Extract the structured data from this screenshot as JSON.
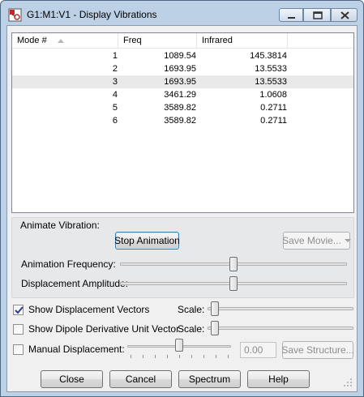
{
  "window": {
    "title": "G1:M1:V1 - Display Vibrations"
  },
  "list": {
    "columns": {
      "mode": "Mode #",
      "freq": "Freq",
      "infrared": "Infrared"
    },
    "rows": [
      {
        "mode": "1",
        "freq": "1089.54",
        "infrared": "145.3814"
      },
      {
        "mode": "2",
        "freq": "1693.95",
        "infrared": "13.5533"
      },
      {
        "mode": "3",
        "freq": "1693.95",
        "infrared": "13.5533"
      },
      {
        "mode": "4",
        "freq": "3461.29",
        "infrared": "1.0608"
      },
      {
        "mode": "5",
        "freq": "3589.82",
        "infrared": "0.2711"
      },
      {
        "mode": "6",
        "freq": "3589.82",
        "infrared": "0.2711"
      }
    ],
    "selected_mode": "3"
  },
  "animation": {
    "section_label": "Animate Vibration:",
    "stop_button": "Stop Animation",
    "save_movie_button": "Save Movie...",
    "frequency_label": "Animation Frequency:",
    "frequency_level": 0.5,
    "amplitude_label": "Displacement Amplitude:",
    "amplitude_level": 0.5
  },
  "options": {
    "show_vectors": {
      "label": "Show Displacement Vectors",
      "checked": true,
      "scale_label": "Scale:",
      "scale_level": 0.05
    },
    "show_dipole": {
      "label": "Show Dipole Derivative Unit Vector",
      "checked": false,
      "scale_label": "Scale:",
      "scale_level": 0.05
    },
    "manual": {
      "label": "Manual Displacement:",
      "checked": false,
      "value": "0.00",
      "level": 0.5,
      "save_structure_button": "Save Structure..."
    }
  },
  "buttons": {
    "close": "Close",
    "cancel": "Cancel",
    "spectrum": "Spectrum",
    "help": "Help"
  },
  "icons": {
    "app": "gaussview-icon",
    "minimize": "minimize-icon",
    "maximize": "maximize-icon",
    "close": "close-icon",
    "sort": "sort-ascending-icon",
    "check": "checkmark-icon",
    "grip": "resize-grip-icon"
  }
}
